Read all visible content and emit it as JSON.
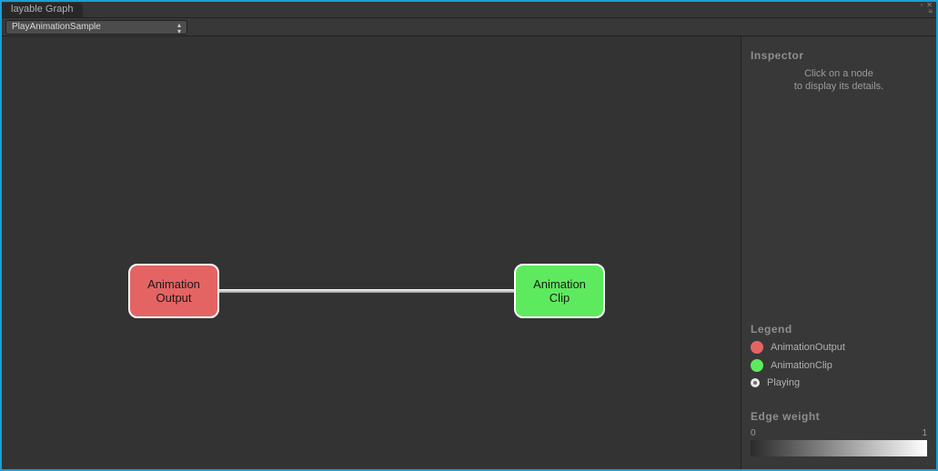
{
  "window": {
    "tab_title": "layable Graph"
  },
  "toolbar": {
    "dropdown_value": "PlayAnimationSample"
  },
  "graph": {
    "nodes": {
      "output": {
        "line1": "Animation",
        "line2": "Output"
      },
      "clip": {
        "line1": "Animation",
        "line2": "Clip"
      }
    }
  },
  "inspector": {
    "title": "Inspector",
    "hint_line1": "Click on a node",
    "hint_line2": "to display its details."
  },
  "legend": {
    "title": "Legend",
    "items": {
      "output": "AnimationOutput",
      "clip": "AnimationClip",
      "playing": "Playing"
    }
  },
  "edge_weight": {
    "title": "Edge weight",
    "min": "0",
    "max": "1"
  },
  "colors": {
    "node_output": "#e46464",
    "node_clip": "#5eea5e",
    "panel_bg": "#383838",
    "graph_bg": "#333333"
  }
}
